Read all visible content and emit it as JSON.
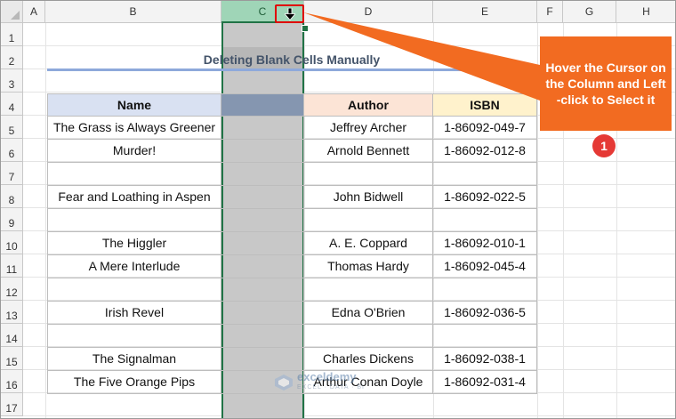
{
  "spreadsheet": {
    "columns": [
      "A",
      "B",
      "C",
      "D",
      "E",
      "F",
      "G",
      "H"
    ],
    "selected_column": "C",
    "rows": [
      "1",
      "2",
      "3",
      "4",
      "5",
      "6",
      "7",
      "8",
      "9",
      "10",
      "11",
      "12",
      "13",
      "14",
      "15",
      "16",
      "17"
    ]
  },
  "title": "Deleting Blank Cells Manually",
  "table": {
    "headers": {
      "name": "Name",
      "author": "Author",
      "isbn": "ISBN"
    },
    "rows": [
      {
        "name": "The Grass is Always Greener",
        "author": "Jeffrey Archer",
        "isbn": "1-86092-049-7"
      },
      {
        "name": "Murder!",
        "author": "Arnold Bennett",
        "isbn": "1-86092-012-8"
      },
      {
        "name": "",
        "author": "",
        "isbn": ""
      },
      {
        "name": "Fear and Loathing in Aspen",
        "author": "John Bidwell",
        "isbn": "1-86092-022-5"
      },
      {
        "name": "",
        "author": "",
        "isbn": ""
      },
      {
        "name": "The Higgler",
        "author": "A. E. Coppard",
        "isbn": "1-86092-010-1"
      },
      {
        "name": "A Mere Interlude",
        "author": "Thomas Hardy",
        "isbn": "1-86092-045-4"
      },
      {
        "name": "",
        "author": "",
        "isbn": ""
      },
      {
        "name": "Irish Revel",
        "author": "Edna O'Brien",
        "isbn": "1-86092-036-5"
      },
      {
        "name": "",
        "author": "",
        "isbn": ""
      },
      {
        "name": "The Signalman",
        "author": "Charles Dickens",
        "isbn": "1-86092-038-1"
      },
      {
        "name": "The Five Orange Pips",
        "author": "Arthur Conan Doyle",
        "isbn": "1-86092-031-4"
      }
    ]
  },
  "callout": {
    "text": "Hover the Cursor on the Column and Left -click to Select it",
    "step": "1"
  },
  "watermark": {
    "name": "exceldemy",
    "tagline": "EXCEL · DATA · BI"
  },
  "colors": {
    "header_name": "#d9e1f2",
    "header_author": "#fce4d6",
    "header_isbn": "#fff2cc",
    "selection": "#217346",
    "callout": "#f26b21",
    "badge": "#e53935",
    "highlight_box": "#e00000"
  },
  "icons": {
    "cursor": "down-arrow-cursor-icon"
  }
}
